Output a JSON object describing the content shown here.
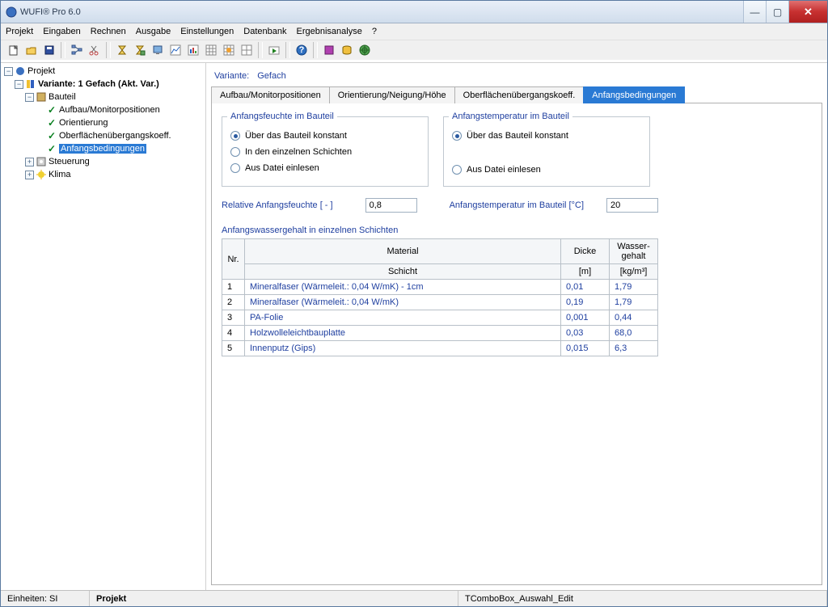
{
  "app": {
    "title": "WUFI® Pro 6.0"
  },
  "menu": [
    "Projekt",
    "Eingaben",
    "Rechnen",
    "Ausgabe",
    "Einstellungen",
    "Datenbank",
    "Ergebnisanalyse",
    "?"
  ],
  "tree": {
    "root": "Projekt",
    "variant": "Variante: 1 Gefach (Akt. Var.)",
    "bauteil": "Bauteil",
    "b_items": [
      "Aufbau/Monitorpositionen",
      "Orientierung",
      "Oberflächenübergangskoeff.",
      "Anfangsbedingungen"
    ],
    "steuerung": "Steuerung",
    "klima": "Klima"
  },
  "main": {
    "title_prefix": "Variante:",
    "title_value": "Gefach",
    "tabs": [
      "Aufbau/Monitorpositionen",
      "Orientierung/Neigung/Höhe",
      "Oberflächenübergangskoeff.",
      "Anfangsbedingungen"
    ]
  },
  "groups": {
    "moisture_title": "Anfangsfeuchte im Bauteil",
    "moisture_opts": [
      "Über das Bauteil konstant",
      "In den einzelnen Schichten",
      "Aus Datei einlesen"
    ],
    "temp_title": "Anfangstemperatur im Bauteil",
    "temp_opts": [
      "Über das Bauteil konstant",
      "Aus Datei einlesen"
    ]
  },
  "inputs": {
    "rel_label": "Relative  Anfangsfeuchte   [ - ]",
    "rel_value": "0,8",
    "temp_label": "Anfangstemperatur im Bauteil [°C]",
    "temp_value": "20"
  },
  "table": {
    "title": "Anfangswassergehalt in einzelnen Schichten",
    "head_nr": "Nr.",
    "head_mat1": "Material",
    "head_mat2": "Schicht",
    "head_dicke1": "Dicke",
    "head_dicke2": "[m]",
    "head_w1": "Wasser-",
    "head_w2": "gehalt",
    "head_w3": "[kg/m³]",
    "rows": [
      {
        "nr": "1",
        "mat": "Mineralfaser (Wärmeleit.: 0,04 W/mK) - 1cm",
        "d": "0,01",
        "w": "1,79"
      },
      {
        "nr": "2",
        "mat": "Mineralfaser (Wärmeleit.: 0,04 W/mK)",
        "d": "0,19",
        "w": "1,79"
      },
      {
        "nr": "3",
        "mat": "PA-Folie",
        "d": "0,001",
        "w": "0,44"
      },
      {
        "nr": "4",
        "mat": "Holzwolleleichtbauplatte",
        "d": "0,03",
        "w": "68,0"
      },
      {
        "nr": "5",
        "mat": "Innenputz (Gips)",
        "d": "0,015",
        "w": "6,3"
      }
    ]
  },
  "status": {
    "units": "Einheiten: SI",
    "proj": "Projekt",
    "combo": "TComboBox_Auswahl_Edit"
  }
}
